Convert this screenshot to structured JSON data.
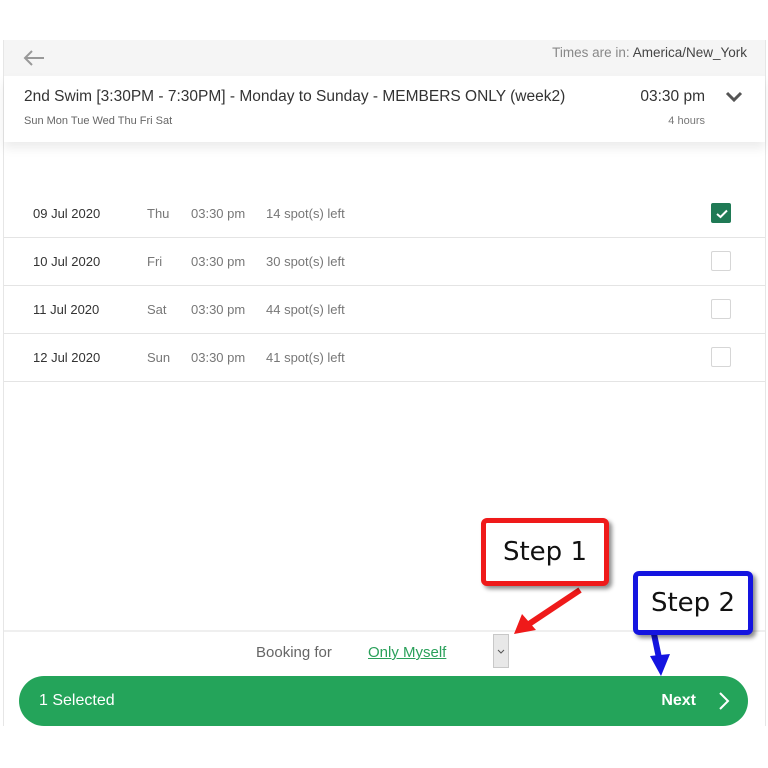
{
  "header": {
    "timezone_label": "Times are in:",
    "timezone_value": "America/New_York"
  },
  "session": {
    "title": "2nd Swim [3:30PM - 7:30PM] - Monday to Sunday - MEMBERS ONLY (week2)",
    "days": "Sun Mon Tue Wed Thu Fri Sat",
    "time": "03:30 pm",
    "duration": "4 hours"
  },
  "slots": [
    {
      "date": "09 Jul 2020",
      "day": "Thu",
      "time": "03:30 pm",
      "spots": "14 spot(s) left",
      "checked": true
    },
    {
      "date": "10 Jul 2020",
      "day": "Fri",
      "time": "03:30 pm",
      "spots": "30 spot(s) left",
      "checked": false
    },
    {
      "date": "11 Jul 2020",
      "day": "Sat",
      "time": "03:30 pm",
      "spots": "44 spot(s) left",
      "checked": false
    },
    {
      "date": "12 Jul 2020",
      "day": "Sun",
      "time": "03:30 pm",
      "spots": "41 spot(s) left",
      "checked": false
    }
  ],
  "booking": {
    "label": "Booking for",
    "value": "Only Myself"
  },
  "footer": {
    "selected": "1  Selected",
    "next": "Next"
  },
  "annotations": {
    "step1": "Step 1",
    "step2": "Step 2"
  },
  "colors": {
    "primary_green": "#24a45a",
    "checkbox_green": "#1f7a55",
    "link_green": "#2aa05a",
    "step1_red": "#ef1a1a",
    "step2_blue": "#1414e0"
  }
}
